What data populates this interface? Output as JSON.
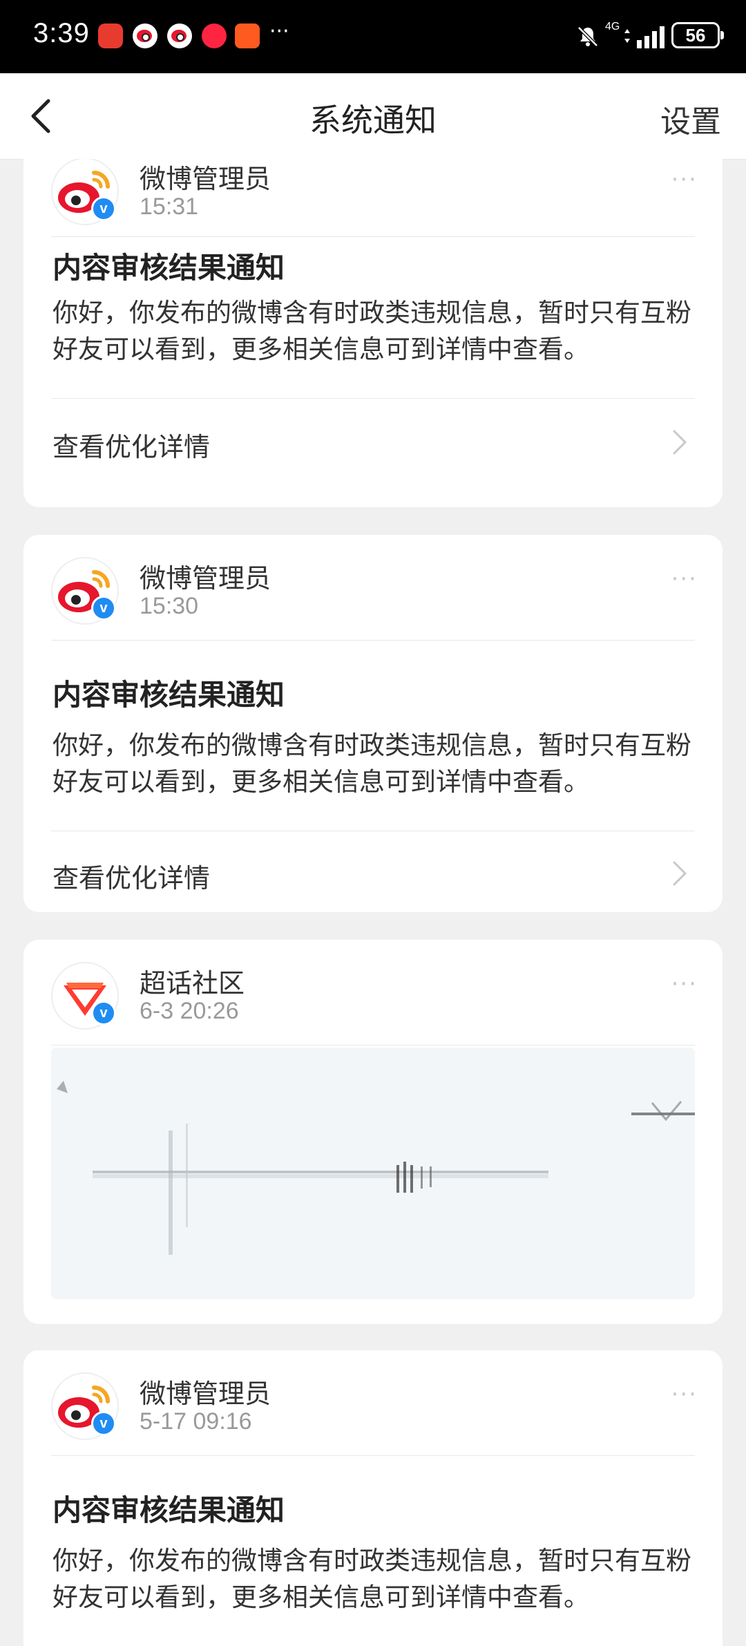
{
  "status_bar": {
    "time": "3:39",
    "network": "4G",
    "battery": "56"
  },
  "nav": {
    "title": "系统通知",
    "settings": "设置"
  },
  "notifications": [
    {
      "sender": "微博管理员",
      "time": "15:31",
      "title": "内容审核结果通知",
      "body": "你好，你发布的微博含有时政类违规信息，暂时只有互粉好友可以看到，更多相关信息可到详情中查看。",
      "action": "查看优化详情"
    },
    {
      "sender": "微博管理员",
      "time": "15:30",
      "title": "内容审核结果通知",
      "body": "你好，你发布的微博含有时政类违规信息，暂时只有互粉好友可以看到，更多相关信息可到详情中查看。",
      "action": "查看优化详情"
    },
    {
      "sender": "超话社区",
      "time": "6-3 20:26"
    },
    {
      "sender": "微博管理员",
      "time": "5-17 09:16",
      "title": "内容审核结果通知",
      "body": "你好，你发布的微博含有时政类违规信息，暂时只有互粉好友可以看到，更多相关信息可到详情中查看。"
    }
  ],
  "icons": {
    "verified": "verified-badge-icon",
    "more": "more-dots-icon",
    "chevron": "chevron-right-icon",
    "back": "back-arrow-icon"
  },
  "colors": {
    "weibo_red": "#e6162d",
    "verified_blue": "#1f8cf3",
    "supertopic_red": "#ff3b30"
  }
}
